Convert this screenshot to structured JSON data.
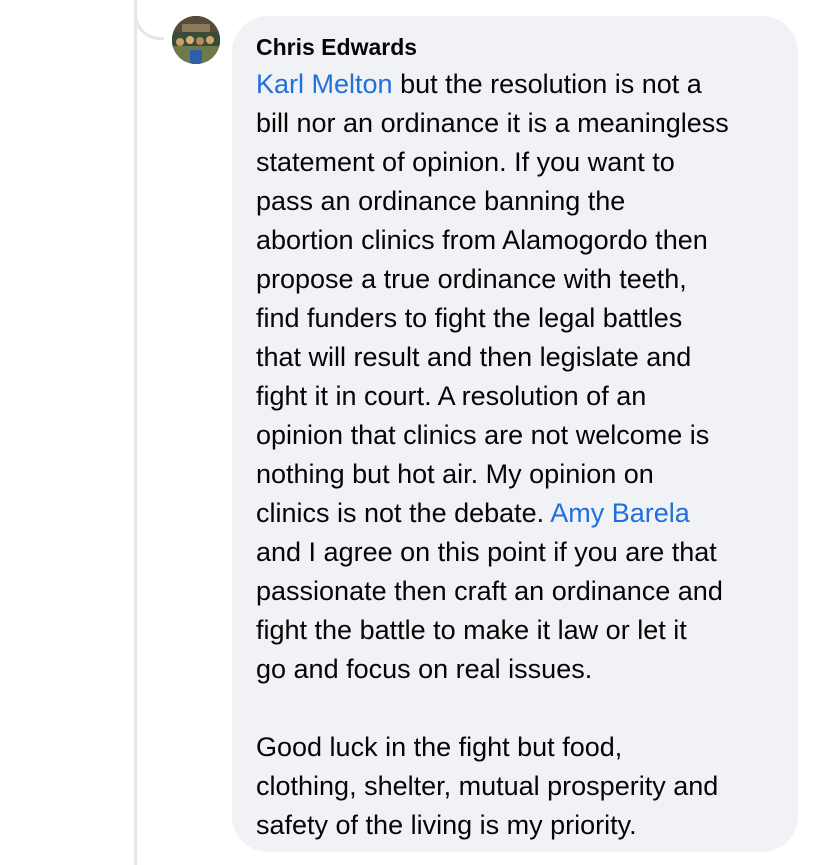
{
  "comment": {
    "author": "Chris Edwards",
    "mention_1": "Karl Melton",
    "mention_2": "Amy Barela",
    "lines": [
      " but the resolution is not a",
      "bill nor an ordinance it is a meaningless",
      "statement of opinion. If you want to",
      "pass an ordinance banning the",
      "abortion clinics from Alamogordo then",
      "propose a true ordinance with teeth,",
      "find funders to fight the legal battles",
      "that will result and then legislate and",
      "fight it in court. A resolution of an",
      "opinion that clinics are not welcome is",
      "nothing but hot air. My opinion on",
      "clinics is not the debate. ",
      "and I agree on this point if you are that",
      "passionate then craft an ordinance and",
      "fight the battle to make it law or let it",
      "go and focus on real issues.",
      "Good luck in the fight but food,",
      "clothing, shelter, mutual prosperity and",
      "safety of the living is my priority."
    ]
  },
  "colors": {
    "bubble": "#f0f2f5",
    "mention": "#216fdb",
    "text": "#050505",
    "thread_line": "#e4e6eb"
  },
  "icons": {
    "avatar": "profile-photo"
  }
}
